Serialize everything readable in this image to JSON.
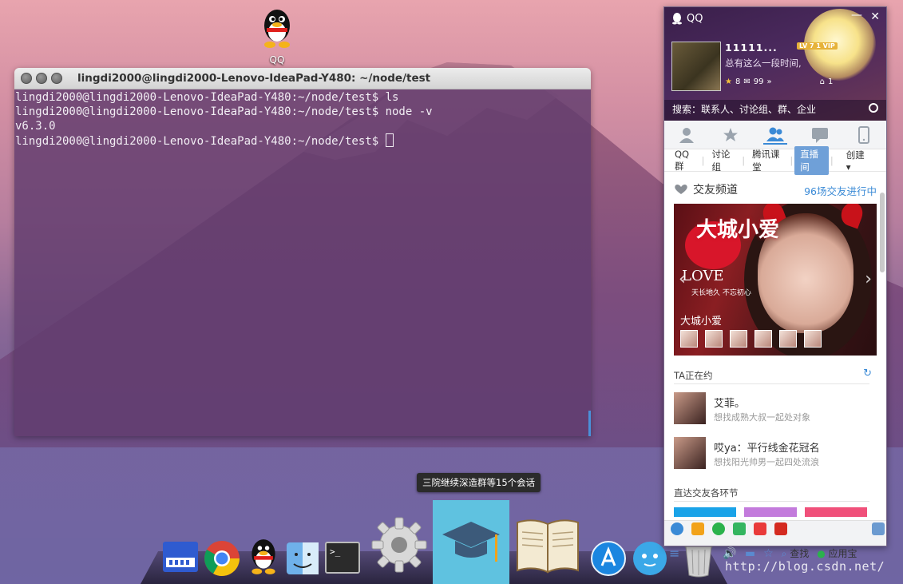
{
  "desktop": {
    "icon_label": "QQ"
  },
  "terminal": {
    "title": "lingdi2000@lingdi2000-Lenovo-IdeaPad-Y480: ~/node/test",
    "lines": [
      "lingdi2000@lingdi2000-Lenovo-IdeaPad-Y480:~/node/test$ ls",
      "lingdi2000@lingdi2000-Lenovo-IdeaPad-Y480:~/node/test$ node -v",
      "v6.3.0",
      "lingdi2000@lingdi2000-Lenovo-IdeaPad-Y480:~/node/test$ "
    ]
  },
  "dock": {
    "tooltip": "三院继续深造群等15个会话",
    "items": [
      "sheet-app-icon",
      "chrome-icon",
      "qq-icon",
      "finder-icon",
      "terminal-icon",
      "settings-gear-icon",
      "graduation-cap-icon",
      "book-icon",
      "app-store-icon",
      "chat-bubble-icon",
      "trash-icon"
    ]
  },
  "watermark": "http://blog.csdn.net/",
  "qq": {
    "app_title": "QQ",
    "nickname": "11111...",
    "vip_badge": "LV 7 1 VIP",
    "signature": "总有这么一段时间,",
    "badge_star_count": "8",
    "badge_mail_count": "99",
    "badge_right_count": "1",
    "search_placeholder": "搜索：联系人、讨论组、群、企业",
    "sub_tabs": [
      "QQ群",
      "讨论组",
      "腾讯课堂",
      "直播间",
      "创建"
    ],
    "active_sub_tab": "直播间",
    "section_title": "交友频道",
    "section_link": "96场交友进行中",
    "banner": {
      "title": "大城小爱",
      "love": "LOVE",
      "tagline": "天长地久 不忘初心",
      "caption": "大城小爱"
    },
    "ta_title": "TA正在约",
    "people": [
      {
        "name": "艾菲。",
        "desc": "想找成熟大叔一起处对象"
      },
      {
        "name": "哎ya：平行线金花冠名",
        "desc": "想找阳光帅男一起四处流浪"
      }
    ],
    "direct_title": "直达交友各环节",
    "color_bars": [
      "#1aa3e8",
      "#c37bdc",
      "#f0507a"
    ],
    "bottom": {
      "find": "查找",
      "app_center": "应用宝"
    },
    "colors": {
      "accent": "#3a8ad6",
      "active_tab": "#6fa0d8",
      "header_bg": "#4b2a5e"
    }
  }
}
